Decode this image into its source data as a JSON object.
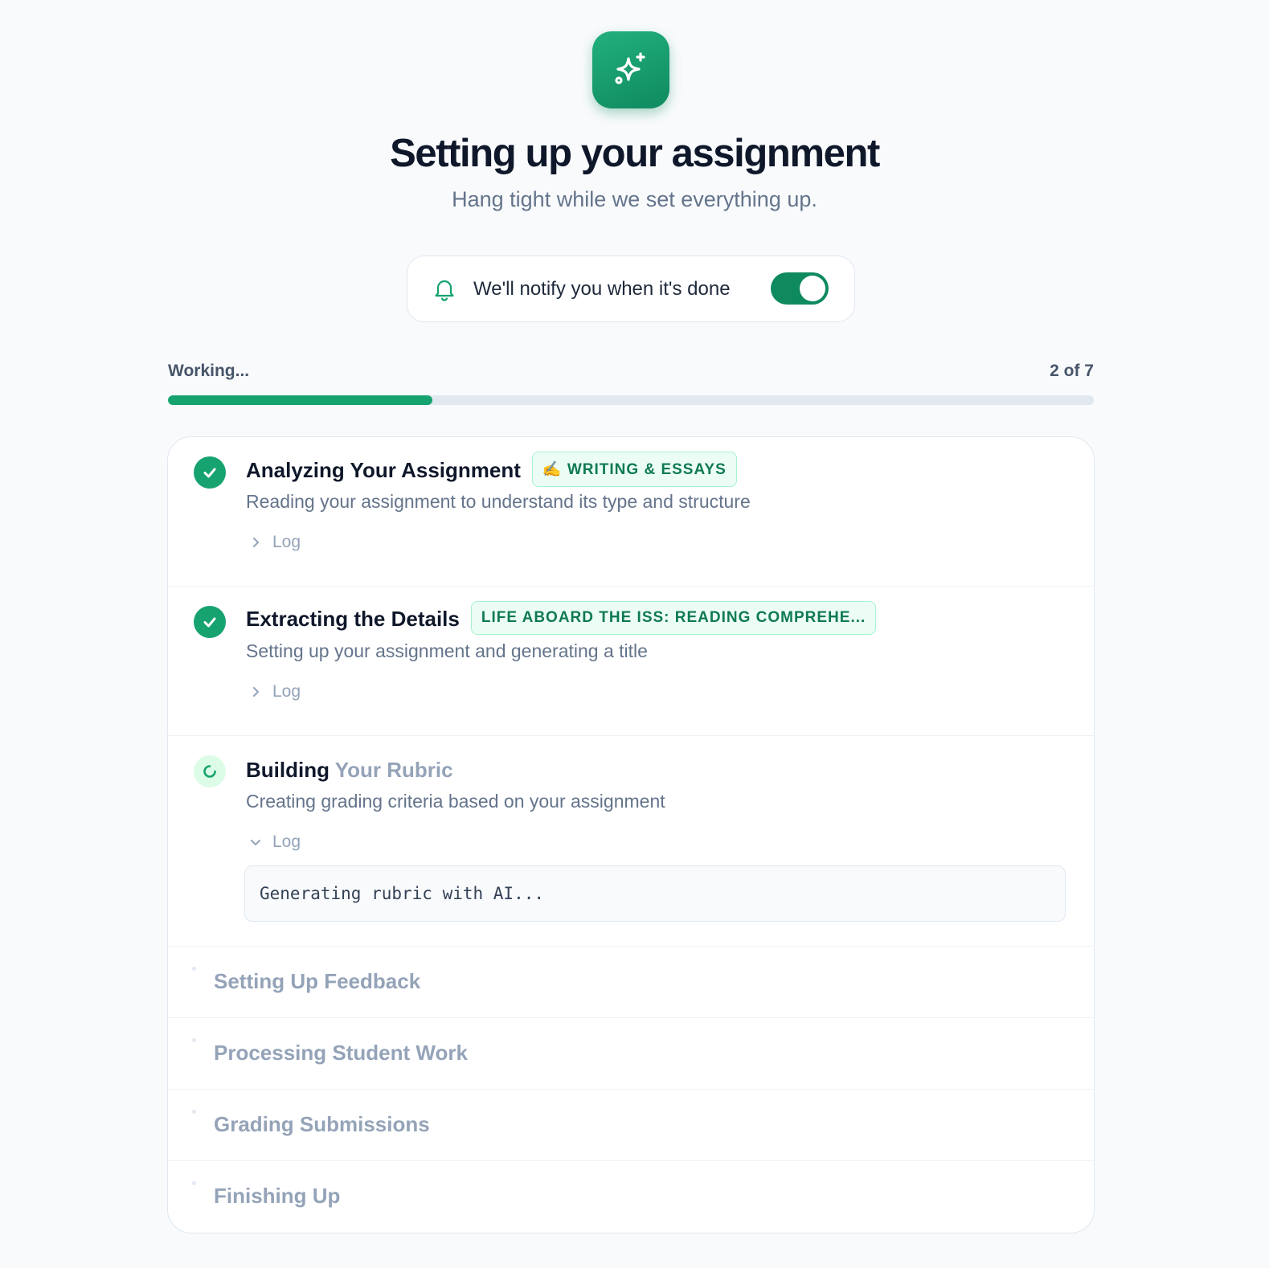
{
  "header": {
    "app_icon": "sparkles-icon",
    "title": "Setting up your assignment",
    "subtitle": "Hang tight while we set everything up."
  },
  "notify": {
    "icon": "bell-icon",
    "text": "We'll notify you when it's done",
    "enabled": true
  },
  "progress": {
    "label": "Working...",
    "count_text": "2 of 7",
    "completed": 2,
    "total": 7
  },
  "steps": [
    {
      "title": "Analyzing Your Assignment",
      "badge": "✍️ WRITING & ESSAYS",
      "description": "Reading your assignment to understand its type and structure",
      "status": "done",
      "log_label": "Log",
      "log_expanded": false
    },
    {
      "title": "Extracting the Details",
      "badge": "LIFE ABOARD THE ISS: READING COMPREHE...",
      "description": "Setting up your assignment and generating a title",
      "status": "done",
      "log_label": "Log",
      "log_expanded": false
    },
    {
      "title_strong": "Building",
      "title_dim": " Your Rubric",
      "description": "Creating grading criteria based on your assignment",
      "status": "in-progress",
      "log_label": "Log",
      "log_expanded": true,
      "log_text": "Generating rubric with AI..."
    },
    {
      "title": "Setting Up Feedback",
      "status": "pending"
    },
    {
      "title": "Processing Student Work",
      "status": "pending"
    },
    {
      "title": "Grading Submissions",
      "status": "pending"
    },
    {
      "title": "Finishing Up",
      "status": "pending"
    }
  ],
  "colors": {
    "accent": "#16a36f",
    "accent_dark": "#0f8a5f",
    "muted_text": "#64748b",
    "pending_text": "#94a3b8"
  }
}
